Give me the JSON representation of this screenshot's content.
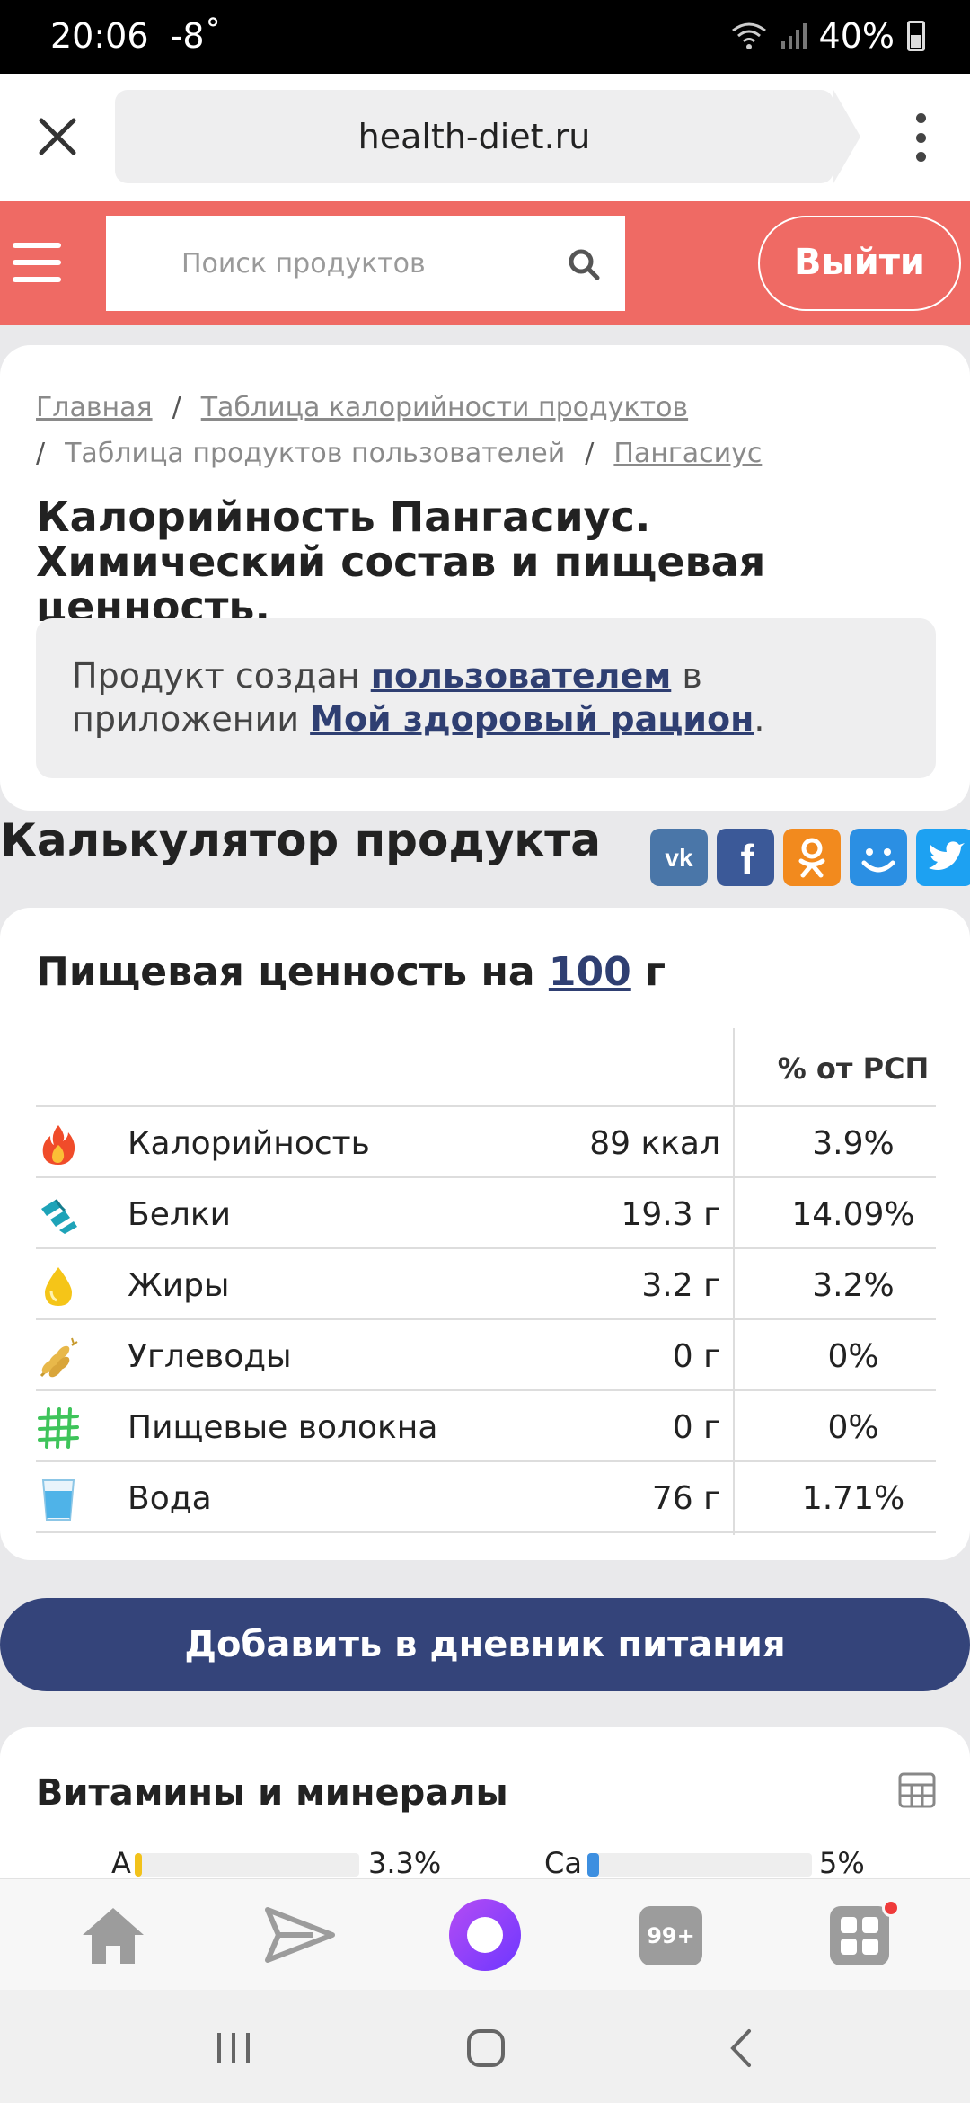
{
  "status": {
    "time": "20:06",
    "temp": "-8˚",
    "battery": "40%"
  },
  "browser": {
    "url": "health-diet.ru"
  },
  "header": {
    "search_placeholder": "Поиск продуктов",
    "logout_label": "Выйти"
  },
  "breadcrumbs": [
    "Главная",
    "Таблица калорийности продуктов",
    "Таблица продуктов пользователей",
    "Пангасиус"
  ],
  "page_title": "Калорийность Пангасиус. Химический состав и пищевая ценность.",
  "info": {
    "prefix": "Продукт создан ",
    "link_user": "пользователем",
    "middle": " в приложении ",
    "link_app": "Мой здоровый рацион",
    "suffix": "."
  },
  "calculator_heading": "Калькулятор продукта",
  "share": [
    "vk-icon",
    "facebook-icon",
    "odnoklassniki-icon",
    "moimir-icon",
    "twitter-icon"
  ],
  "nutrition": {
    "title_prefix": "Пищевая ценность на ",
    "amount": "100",
    "title_suffix": " г",
    "pct_header": "% от РСП",
    "rows": [
      {
        "icon": "fire-icon",
        "name": "Калорийность",
        "amount": "89 ккал",
        "pct": "3.9%"
      },
      {
        "icon": "protein-icon",
        "name": "Белки",
        "amount": "19.3 г",
        "pct": "14.09%"
      },
      {
        "icon": "oil-drop-icon",
        "name": "Жиры",
        "amount": "3.2 г",
        "pct": "3.2%"
      },
      {
        "icon": "wheat-icon",
        "name": "Углеводы",
        "amount": "0 г",
        "pct": "0%"
      },
      {
        "icon": "fiber-grid-icon",
        "name": "Пищевые волокна",
        "amount": "0 г",
        "pct": "0%"
      },
      {
        "icon": "water-glass-icon",
        "name": "Вода",
        "amount": "76 г",
        "pct": "1.71%"
      }
    ]
  },
  "add_button": "Добавить в дневник питания",
  "vitamins": {
    "title": "Витамины и минералы",
    "items": [
      {
        "label": "A",
        "pct": "3.3%",
        "fill": 0.033,
        "color": "#f2c21b"
      },
      {
        "label": "Ca",
        "pct": "5%",
        "fill": 0.05,
        "color": "#3d8fe0"
      }
    ]
  },
  "nav": {
    "badge": "99+"
  }
}
